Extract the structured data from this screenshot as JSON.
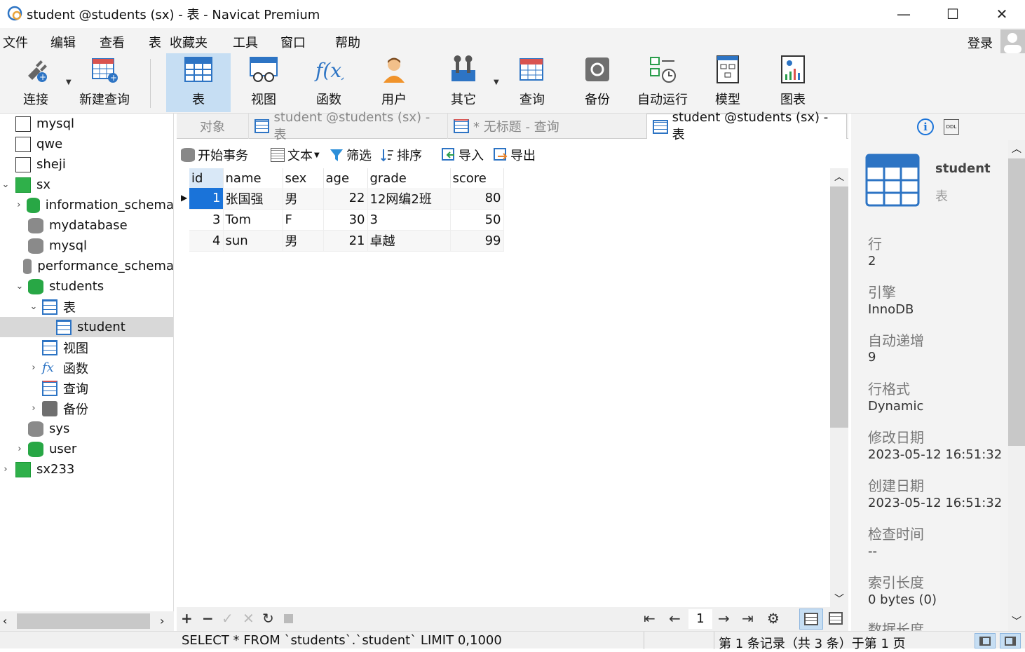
{
  "window": {
    "title": "student @students (sx) - 表 - Navicat Premium",
    "minimize": "—",
    "maximize": "☐",
    "close": "✕"
  },
  "menu": [
    "文件",
    "编辑",
    "查看",
    "表",
    "收藏夹",
    "工具",
    "窗口",
    "帮助"
  ],
  "login_label": "登录",
  "toolbar": [
    {
      "label": "连接",
      "icon": "plug-icon"
    },
    {
      "label": "新建查询",
      "icon": "new-query-icon"
    },
    {
      "label": "表",
      "icon": "table-icon"
    },
    {
      "label": "视图",
      "icon": "view-icon"
    },
    {
      "label": "函数",
      "icon": "function-icon"
    },
    {
      "label": "用户",
      "icon": "user-icon"
    },
    {
      "label": "其它",
      "icon": "tools-icon"
    },
    {
      "label": "查询",
      "icon": "query-icon"
    },
    {
      "label": "备份",
      "icon": "backup-icon"
    },
    {
      "label": "自动运行",
      "icon": "autorun-icon"
    },
    {
      "label": "模型",
      "icon": "model-icon"
    },
    {
      "label": "图表",
      "icon": "chart-icon"
    }
  ],
  "tree": [
    {
      "label": "mysql"
    },
    {
      "label": "qwe"
    },
    {
      "label": "sheji"
    },
    {
      "label": "sx"
    },
    {
      "label": "information_schema"
    },
    {
      "label": "mydatabase"
    },
    {
      "label": "mysql"
    },
    {
      "label": "performance_schema"
    },
    {
      "label": "students"
    },
    {
      "label": "表"
    },
    {
      "label": "student"
    },
    {
      "label": "视图"
    },
    {
      "label": "函数"
    },
    {
      "label": "查询"
    },
    {
      "label": "备份"
    },
    {
      "label": "sys"
    },
    {
      "label": "user"
    },
    {
      "label": "sx233"
    }
  ],
  "tabs": {
    "objects": "对象",
    "tab1": "student @students (sx) - 表",
    "tab2": "* 无标题 - 查询",
    "tab3": "student @students (sx) - 表"
  },
  "subtoolbar": {
    "begin_tx": "开始事务",
    "text": "文本",
    "filter": "筛选",
    "sort": "排序",
    "import": "导入",
    "export": "导出"
  },
  "grid": {
    "columns": [
      "id",
      "name",
      "sex",
      "age",
      "grade",
      "score"
    ],
    "rows": [
      [
        "1",
        "张国强",
        "男",
        "22",
        "12网编2班",
        "80"
      ],
      [
        "3",
        "Tom",
        "F",
        "30",
        "3",
        "50"
      ],
      [
        "4",
        "sun",
        "男",
        "21",
        "卓越",
        "99"
      ]
    ]
  },
  "pager": {
    "page": "1"
  },
  "status": {
    "sql": "SELECT * FROM `students`.`student` LIMIT 0,1000",
    "record": "第 1 条记录（共 3 条）于第 1 页"
  },
  "info": {
    "name": "student",
    "type": "表",
    "fields": [
      {
        "label": "行",
        "value": "2"
      },
      {
        "label": "引擎",
        "value": "InnoDB"
      },
      {
        "label": "自动递增",
        "value": "9"
      },
      {
        "label": "行格式",
        "value": "Dynamic"
      },
      {
        "label": "修改日期",
        "value": "2023-05-12 16:51:32"
      },
      {
        "label": "创建日期",
        "value": "2023-05-12 16:51:32"
      },
      {
        "label": "检查时间",
        "value": "--"
      },
      {
        "label": "索引长度",
        "value": "0 bytes (0)"
      },
      {
        "label": "数据长度",
        "value": ""
      }
    ]
  },
  "colors": {
    "accent": "#1a73d9",
    "active_tool": "#c6def3",
    "db_green": "#28a745"
  }
}
